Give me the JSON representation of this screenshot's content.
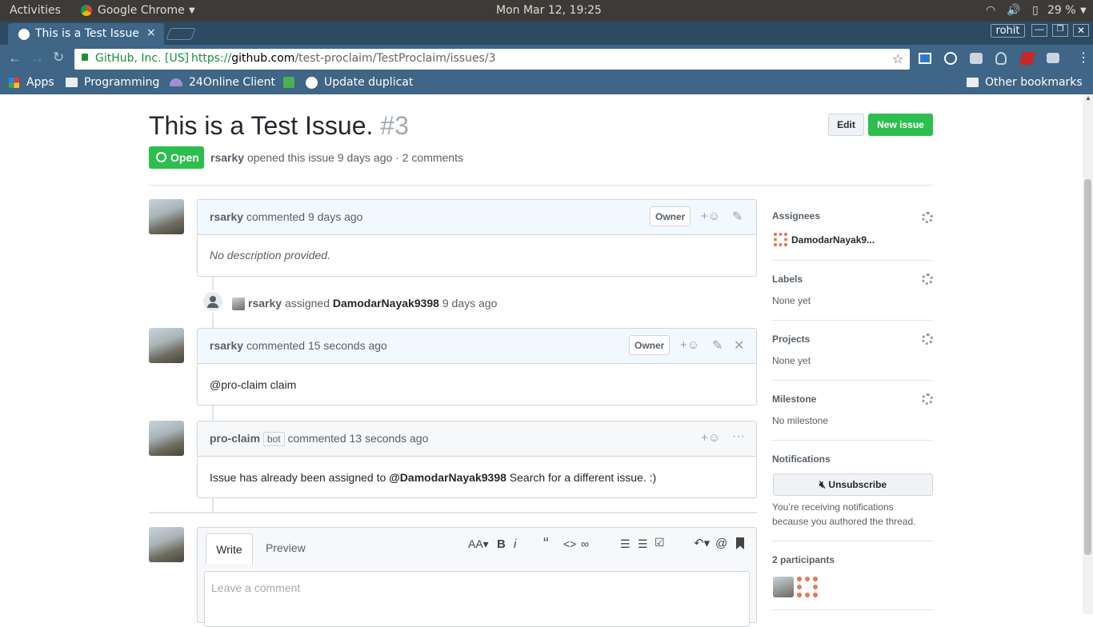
{
  "os": {
    "activities": "Activities",
    "app_menu": "Google Chrome",
    "clock": "Mon Mar 12, 19:25",
    "battery": "29 %"
  },
  "browser": {
    "tab_title": "This is a Test Issue. ·",
    "tab_close": "×",
    "user": "rohit",
    "security": "GitHub, Inc. [US]",
    "url_scheme": "https://",
    "url_host": "github.com",
    "url_path": "/test-proclaim/TestProclaim/issues/3",
    "bookmarks": [
      "Apps",
      "Programming",
      "24Online Client",
      "",
      "Update duplicat"
    ],
    "other_bookmarks": "Other bookmarks"
  },
  "issue": {
    "title": "This is a Test Issue.",
    "number": "#3",
    "state": "Open",
    "author": "rsarky",
    "meta": "opened this issue 9 days ago · 2 comments",
    "edit": "Edit",
    "new_issue": "New issue"
  },
  "timeline": {
    "c1": {
      "author": "rsarky",
      "action": "commented 9 days ago",
      "badge": "Owner",
      "body": "No description provided."
    },
    "event": {
      "actor": "rsarky",
      "verb": "assigned",
      "assignee": "DamodarNayak9398",
      "time": "9 days ago"
    },
    "c2": {
      "author": "rsarky",
      "action": "commented 15 seconds ago",
      "badge": "Owner",
      "body": "@pro-claim claim"
    },
    "c3": {
      "author": "pro-claim",
      "bot": "bot",
      "action": "commented 13 seconds ago",
      "body_pre": "Issue has already been assigned to ",
      "body_mention": "@DamodarNayak9398",
      "body_post": " Search for a different issue. :)"
    }
  },
  "editor": {
    "write": "Write",
    "preview": "Preview",
    "placeholder": "Leave a comment"
  },
  "sidebar": {
    "assignees_title": "Assignees",
    "assignee": "DamodarNayak9...",
    "labels_title": "Labels",
    "labels_value": "None yet",
    "projects_title": "Projects",
    "projects_value": "None yet",
    "milestone_title": "Milestone",
    "milestone_value": "No milestone",
    "notifications_title": "Notifications",
    "unsubscribe": "Unsubscribe",
    "notifications_text1": "You’re receiving notifications",
    "notifications_text2": "because you authored the thread.",
    "participants_title": "2 participants"
  },
  "colors": {
    "green": "#2cbe4e",
    "link": "#0366d6",
    "header_bg": "#f1f8ff"
  }
}
